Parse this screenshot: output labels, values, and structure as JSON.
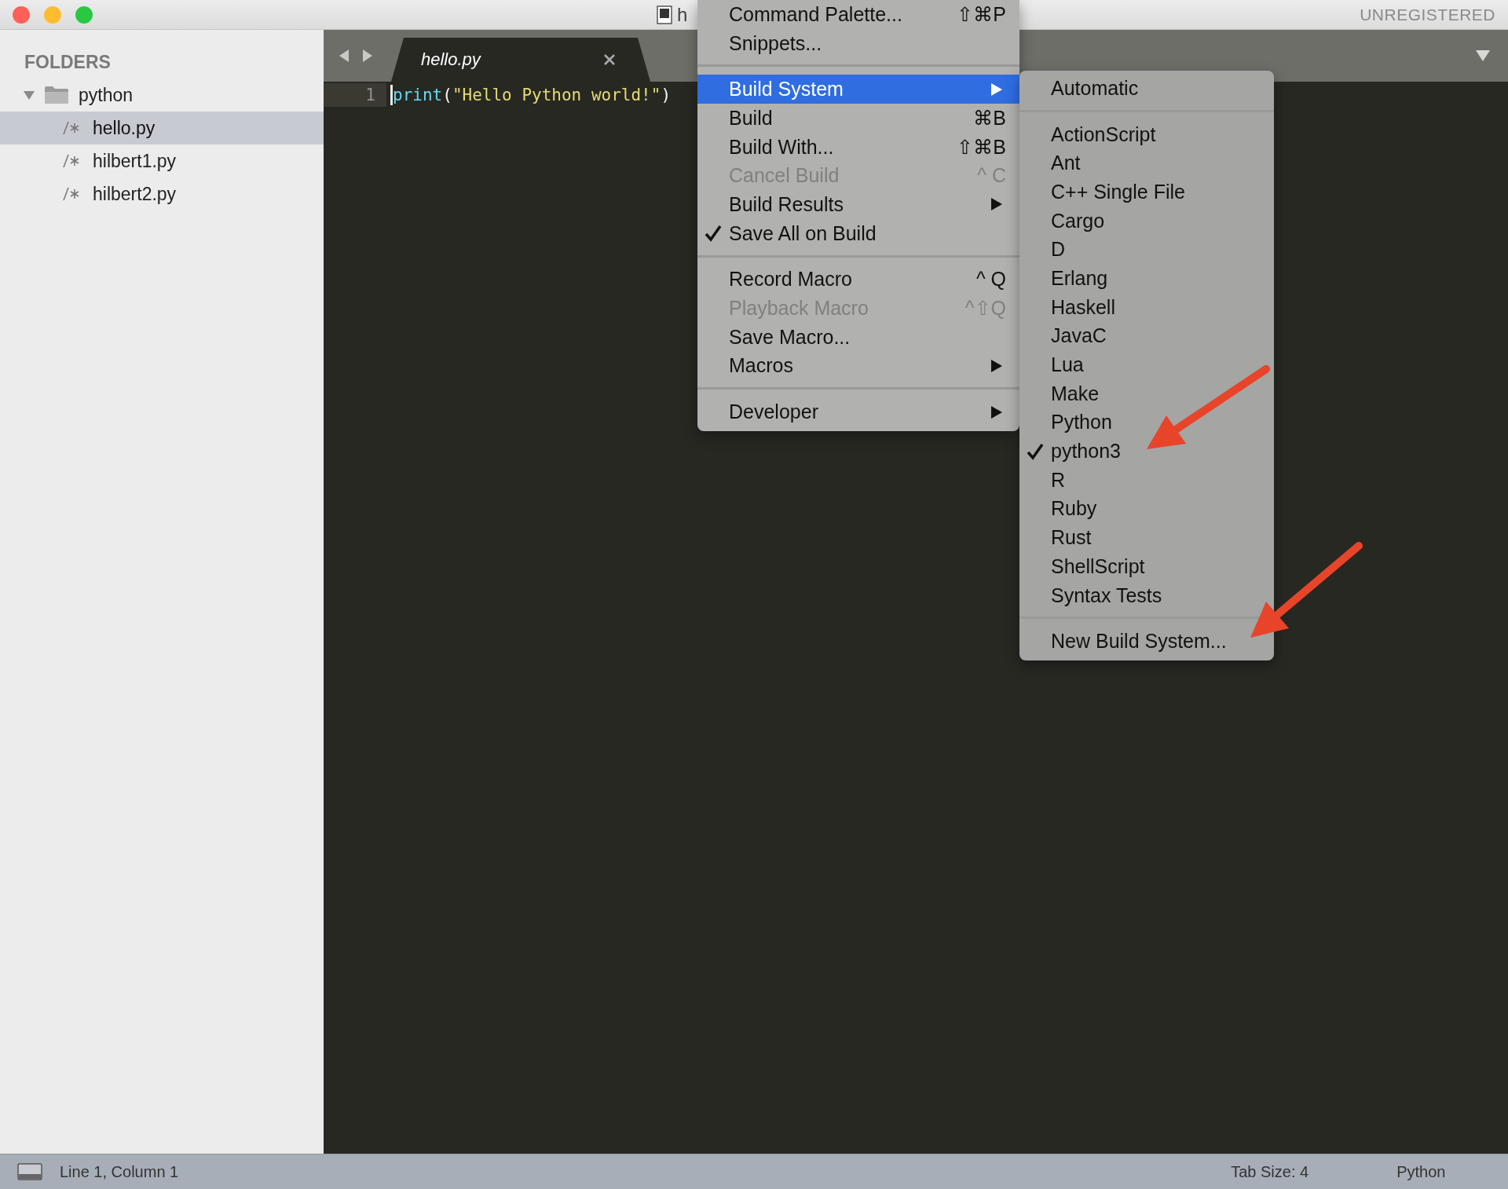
{
  "window": {
    "title": "h",
    "registration": "UNREGISTERED"
  },
  "sidebar": {
    "heading": "FOLDERS",
    "folders": [
      {
        "name": "python",
        "expanded": true,
        "children": [
          {
            "name": "hello.py",
            "selected": true
          },
          {
            "name": "hilbert1.py",
            "selected": false
          },
          {
            "name": "hilbert2.py",
            "selected": false
          }
        ]
      }
    ]
  },
  "tabs": [
    {
      "label": "hello.py",
      "selected": true
    }
  ],
  "editor": {
    "lines": [
      {
        "number": "1",
        "tokens": [
          {
            "kind": "function",
            "text": "print"
          },
          {
            "kind": "punct",
            "text": "("
          },
          {
            "kind": "string",
            "text": "\"Hello Python world!\""
          },
          {
            "kind": "punct",
            "text": ")"
          }
        ]
      }
    ]
  },
  "menu": {
    "items": [
      {
        "kind": "item",
        "label": "Command Palette...",
        "shortcut": "⇧⌘P",
        "selected": false,
        "disabled": false,
        "checked": false,
        "submenu": false
      },
      {
        "kind": "item",
        "label": "Snippets...",
        "selected": false,
        "disabled": false,
        "checked": false,
        "submenu": false
      },
      {
        "kind": "separator"
      },
      {
        "kind": "item",
        "label": "Build System",
        "selected": true,
        "disabled": false,
        "checked": false,
        "submenu": true
      },
      {
        "kind": "item",
        "label": "Build",
        "shortcut": "⌘B",
        "selected": false,
        "disabled": false,
        "checked": false,
        "submenu": false
      },
      {
        "kind": "item",
        "label": "Build With...",
        "shortcut": "⇧⌘B",
        "selected": false,
        "disabled": false,
        "checked": false,
        "submenu": false
      },
      {
        "kind": "item",
        "label": "Cancel Build",
        "shortcut": "^ C",
        "selected": false,
        "disabled": true,
        "checked": false,
        "submenu": false
      },
      {
        "kind": "item",
        "label": "Build Results",
        "selected": false,
        "disabled": false,
        "checked": false,
        "submenu": true
      },
      {
        "kind": "item",
        "label": "Save All on Build",
        "selected": false,
        "disabled": false,
        "checked": true,
        "submenu": false
      },
      {
        "kind": "separator"
      },
      {
        "kind": "item",
        "label": "Record Macro",
        "shortcut": "^ Q",
        "selected": false,
        "disabled": false,
        "checked": false,
        "submenu": false
      },
      {
        "kind": "item",
        "label": "Playback Macro",
        "shortcut": "^⇧Q",
        "selected": false,
        "disabled": true,
        "checked": false,
        "submenu": false
      },
      {
        "kind": "item",
        "label": "Save Macro...",
        "selected": false,
        "disabled": false,
        "checked": false,
        "submenu": false
      },
      {
        "kind": "item",
        "label": "Macros",
        "selected": false,
        "disabled": false,
        "checked": false,
        "submenu": true
      },
      {
        "kind": "separator"
      },
      {
        "kind": "item",
        "label": "Developer",
        "selected": false,
        "disabled": false,
        "checked": false,
        "submenu": true
      }
    ]
  },
  "submenu": {
    "items": [
      {
        "kind": "item",
        "label": "Automatic",
        "checked": false
      },
      {
        "kind": "separator"
      },
      {
        "kind": "item",
        "label": "ActionScript",
        "checked": false
      },
      {
        "kind": "item",
        "label": "Ant",
        "checked": false
      },
      {
        "kind": "item",
        "label": "C++ Single File",
        "checked": false
      },
      {
        "kind": "item",
        "label": "Cargo",
        "checked": false
      },
      {
        "kind": "item",
        "label": "D",
        "checked": false
      },
      {
        "kind": "item",
        "label": "Erlang",
        "checked": false
      },
      {
        "kind": "item",
        "label": "Haskell",
        "checked": false
      },
      {
        "kind": "item",
        "label": "JavaC",
        "checked": false
      },
      {
        "kind": "item",
        "label": "Lua",
        "checked": false
      },
      {
        "kind": "item",
        "label": "Make",
        "checked": false
      },
      {
        "kind": "item",
        "label": "Python",
        "checked": false
      },
      {
        "kind": "item",
        "label": "python3",
        "checked": true
      },
      {
        "kind": "item",
        "label": "R",
        "checked": false
      },
      {
        "kind": "item",
        "label": "Ruby",
        "checked": false
      },
      {
        "kind": "item",
        "label": "Rust",
        "checked": false
      },
      {
        "kind": "item",
        "label": "ShellScript",
        "checked": false
      },
      {
        "kind": "item",
        "label": "Syntax Tests",
        "checked": false
      },
      {
        "kind": "separator"
      },
      {
        "kind": "item",
        "label": "New Build System...",
        "checked": false
      }
    ]
  },
  "status_bar": {
    "position": "Line 1, Column 1",
    "tab_size": "Tab Size: 4",
    "syntax": "Python"
  }
}
